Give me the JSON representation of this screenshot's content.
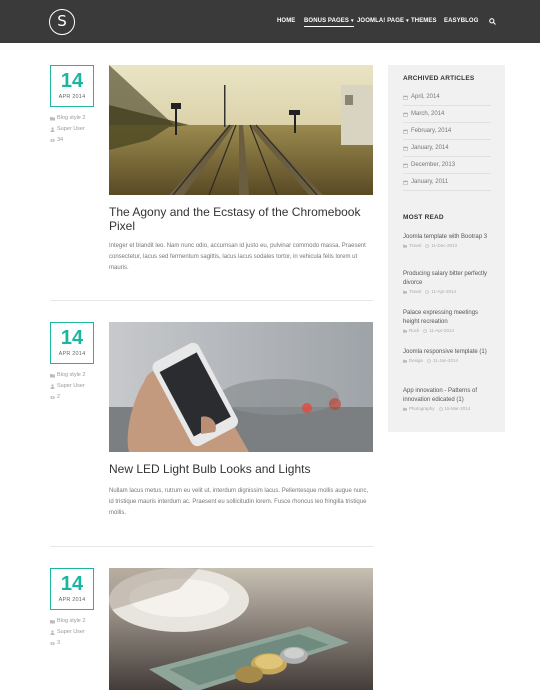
{
  "header": {
    "logo_letter": "S",
    "nav": [
      {
        "label": "HOME",
        "active": false,
        "dropdown": false
      },
      {
        "label": "BONUS PAGES",
        "active": true,
        "dropdown": true
      },
      {
        "label": "JOOMLA! PAGE",
        "active": false,
        "dropdown": true
      },
      {
        "label": "THEMES",
        "active": false,
        "dropdown": false
      },
      {
        "label": "EASYBLOG",
        "active": false,
        "dropdown": false
      }
    ],
    "caret": "▾",
    "search_icon": "search-icon"
  },
  "posts": [
    {
      "day": "14",
      "month": "APR 2014",
      "category": "Blog style 2",
      "author": "Super User",
      "hits": "34",
      "image": "railway-tracks-photo",
      "title": "The Agony and the Ecstasy of the Chromebook Pixel",
      "excerpt": "Integer et blandit leo. Nam nunc odio, accumsan id justo eu, pulvinar commodo massa. Praesent consectetur, lacus sed fermentum sagittis, lacus lacus sodales tortor, in vehicula felis lorem ut mauris."
    },
    {
      "day": "14",
      "month": "APR 2014",
      "category": "Blog style 2",
      "author": "Super User",
      "hits": "2",
      "image": "hand-holding-phone-photo",
      "title": "New LED Light Bulb Looks and Lights",
      "excerpt": "Nullam lacus metus, rutrum eu velit ut, interdum dignissim lacus. Pellentesque mollis augue nunc, id tristique mauris interdum ac. Praesent eu sollicitudin lorem. Fusce rhoncus leo fringilla tristique mollis."
    },
    {
      "day": "14",
      "month": "APR 2014",
      "category": "Blog style 2",
      "author": "Super User",
      "hits": "3",
      "image": "coins-and-cup-photo"
    }
  ],
  "sidebar": {
    "archived_heading": "ARCHIVED ARTICLES",
    "archived": [
      "April, 2014",
      "March, 2014",
      "February, 2014",
      "January, 2014",
      "December, 2013",
      "January, 2011"
    ],
    "most_read_heading": "MOST READ",
    "most_read": [
      {
        "title": "Joomla template with Bootrap 3",
        "category": "Travel",
        "date": "11-Dec-2013"
      },
      {
        "title": "Producing salary bitter perfectly divorce",
        "category": "Travel",
        "date": "11-Apr-2014"
      },
      {
        "title": "Palace expressing meetings height recreation",
        "category": "Rock",
        "date": "11-Apr-2014"
      },
      {
        "title": "Joomla responsive template (1)",
        "category": "Design",
        "date": "11-Jan-2014"
      },
      {
        "title": "App innovation - Patterns of innovation edicated (1)",
        "category": "Photography",
        "date": "15-Mar-2014"
      }
    ]
  },
  "colors": {
    "accent": "#1bb5a0",
    "header_bg": "#3a3a3a",
    "sidebar_bg": "#f1f1f1"
  }
}
